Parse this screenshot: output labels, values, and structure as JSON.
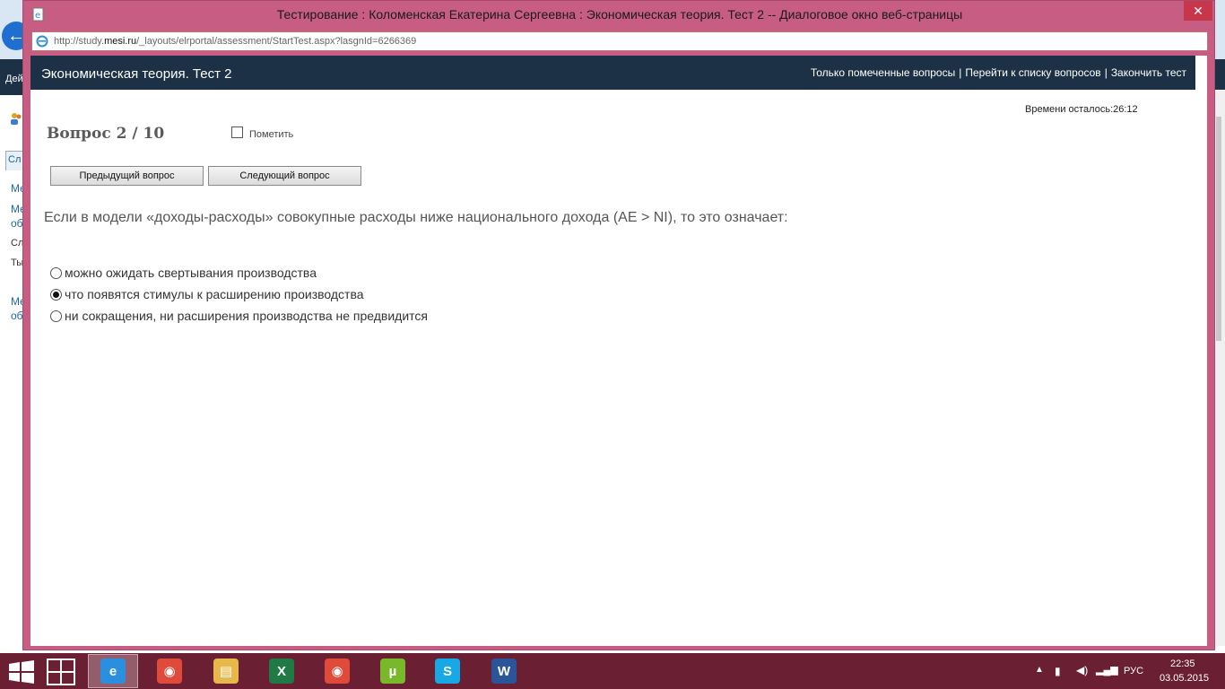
{
  "window": {
    "title": "Тестирование : Коломенская Екатерина Сергеевна : Экономическая теория. Тест 2 -- Диалоговое окно веб-страницы",
    "close_glyph": "✕",
    "url_prefix": "http://study.",
    "url_domain": "mesi.ru",
    "url_suffix": "/_layouts/elrportal/assessment/StartTest.aspx?lasgnId=6266369"
  },
  "background_page": {
    "ribbon_text": "Дей",
    "tab_label": "Сл",
    "sidebar_lines": [
      "Ме",
      "Ме",
      "об",
      "Сл",
      "Ты",
      "Ме",
      "об"
    ]
  },
  "test": {
    "title": "Экономическая теория. Тест 2",
    "header_links": [
      "Только помеченные вопросы",
      "Перейти к списку вопросов",
      "Закончить тест"
    ],
    "link_separator": "|",
    "timer_label": "Времени осталось:",
    "timer_value": "26:12",
    "question_counter": "Вопрос 2 / 10",
    "mark_label": "Пометить",
    "mark_checked": false,
    "prev_button": "Предыдущий вопрос",
    "next_button": "Следующий вопрос",
    "question_text": "Если в модели «доходы-расходы» совокупные расходы ниже национального дохода (AE > NI), то это означает:",
    "options": [
      {
        "label": "можно ожидать свертывания производства",
        "selected": false
      },
      {
        "label": "что появятся стимулы к расширению производства",
        "selected": true
      },
      {
        "label": "ни сокращения, ни расширения производства не предвидится",
        "selected": false
      }
    ]
  },
  "taskbar": {
    "apps": [
      {
        "name": "internet-explorer",
        "glyph": "e",
        "color": "#2b8fe0",
        "active": true
      },
      {
        "name": "chrome",
        "glyph": "◉",
        "color": "#e04a3a",
        "active": false
      },
      {
        "name": "file-explorer",
        "glyph": "▤",
        "color": "#e8b84a",
        "active": false
      },
      {
        "name": "excel",
        "glyph": "X",
        "color": "#1f7a45",
        "active": false
      },
      {
        "name": "chrome",
        "glyph": "◉",
        "color": "#e04a3a",
        "active": false
      },
      {
        "name": "utorrent",
        "glyph": "µ",
        "color": "#78b82a",
        "active": false
      },
      {
        "name": "skype",
        "glyph": "S",
        "color": "#17a8e6",
        "active": false
      },
      {
        "name": "word",
        "glyph": "W",
        "color": "#2a5699",
        "active": false
      }
    ],
    "language": "РУС",
    "time": "22:35",
    "date": "03.05.2015"
  }
}
